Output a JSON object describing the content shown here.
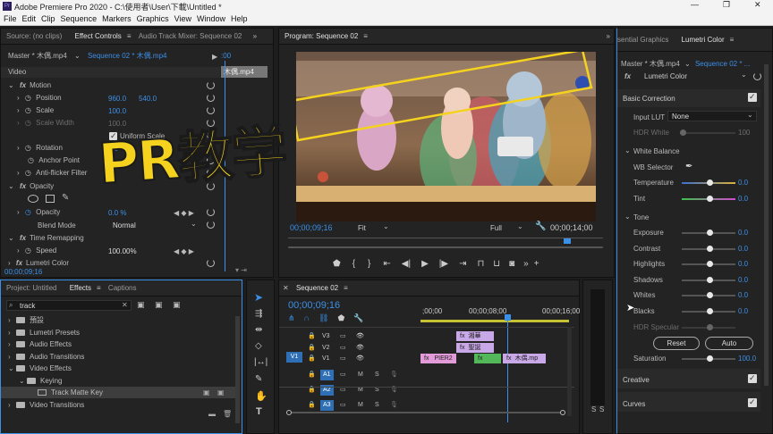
{
  "window": {
    "title": "Adobe Premiere Pro 2020 - C:\\使用者\\User\\下載\\Untitled *",
    "controls": [
      "—",
      "❐",
      "✕"
    ]
  },
  "menu": [
    "File",
    "Edit",
    "Clip",
    "Sequence",
    "Markers",
    "Graphics",
    "View",
    "Window",
    "Help"
  ],
  "effect_controls": {
    "tabs": [
      "Source: (no clips)",
      "Effect Controls",
      "Audio Track Mixer: Sequence 02"
    ],
    "master": "Master * 木偶.mp4",
    "sequence": "Sequence 02 * 木偶.mp4",
    "clip_label": "木偶.mp4",
    "timecode_top": ":00",
    "section_video": "Video",
    "motion": "Motion",
    "position_label": "Position",
    "position_x": "960.0",
    "position_y": "540.0",
    "scale_label": "Scale",
    "scale_value": "100.0",
    "scale_width_label": "Scale Width",
    "scale_width_value": "100.0",
    "uniform_scale": "Uniform Scale",
    "rotation_label": "Rotation",
    "rotation_value": "0.0",
    "anchor_label": "Anchor Point",
    "antiflicker_label": "Anti-flicker Filter",
    "opacity_section": "Opacity",
    "opacity_label": "Opacity",
    "opacity_value": "0.0 %",
    "blend_label": "Blend Mode",
    "blend_value": "Normal",
    "time_remap": "Time Remapping",
    "speed_label": "Speed",
    "speed_value": "100.00%",
    "lumetri": "Lumetri Color",
    "bottom_timecode": "00;00;09;16"
  },
  "program": {
    "title": "Program: Sequence 02",
    "timecode": "00;00;09;16",
    "fit": "Fit",
    "quality": "Full",
    "duration": "00;00;14;00",
    "overlay_text": "PR教学"
  },
  "project": {
    "tabs": [
      "Project: Untitled",
      "Effects",
      "Captions"
    ],
    "search_value": "track",
    "items": [
      {
        "label": "預設",
        "indent": 0
      },
      {
        "label": "Lumetri Presets",
        "indent": 0
      },
      {
        "label": "Audio Effects",
        "indent": 0
      },
      {
        "label": "Audio Transitions",
        "indent": 0
      },
      {
        "label": "Video Effects",
        "indent": 0,
        "open": true
      },
      {
        "label": "Keying",
        "indent": 1,
        "open": true
      },
      {
        "label": "Track Matte Key",
        "indent": 2,
        "selected": true
      },
      {
        "label": "Video Transitions",
        "indent": 0
      }
    ]
  },
  "timeline": {
    "tab": "Sequence 02",
    "timecode": "00;00;09;16",
    "ruler": [
      ";00;00",
      "00;00;08;00",
      "00;00;16;00"
    ],
    "tracks": [
      "V3",
      "V2",
      "V1",
      "A1",
      "A2",
      "A3"
    ],
    "v1_source": "V1",
    "clip_v3": "湘華",
    "clip_v2": "聖誕",
    "clip_v1a": "PIER2",
    "clip_v1b": "木偶.mp",
    "solo": [
      "S",
      "S"
    ]
  },
  "lumetri": {
    "tabs": [
      "sential Graphics",
      "Lumetri Color"
    ],
    "master": "Master * 木偶.mp4",
    "sequence": "Sequence 02 * ...",
    "fx_label": "Lumetri Color",
    "basic_correction": "Basic Correction",
    "input_lut_label": "Input LUT",
    "input_lut_value": "None",
    "hdr_white_label": "HDR White",
    "hdr_white_value": "100",
    "white_balance": "White Balance",
    "wb_selector": "WB Selector",
    "temperature_label": "Temperature",
    "temperature_value": "0.0",
    "tint_label": "Tint",
    "tint_value": "0.0",
    "tone": "Tone",
    "tone_rows": [
      {
        "label": "Exposure",
        "value": "0.0"
      },
      {
        "label": "Contrast",
        "value": "0.0"
      },
      {
        "label": "Highlights",
        "value": "0.0"
      },
      {
        "label": "Shadows",
        "value": "0.0"
      },
      {
        "label": "Whites",
        "value": "0.0"
      },
      {
        "label": "Blacks",
        "value": "0.0"
      }
    ],
    "hdr_specular": "HDR Specular",
    "reset": "Reset",
    "auto": "Auto",
    "saturation_label": "Saturation",
    "saturation_value": "100.0",
    "creative": "Creative",
    "curves": "Curves"
  },
  "colors": {
    "accent": "#3c8fe6",
    "clip_pink": "#e39ad8",
    "clip_purple": "#c9a8e8",
    "clip_green": "#52b85a",
    "overlay_yellow": "#f4d21e"
  }
}
